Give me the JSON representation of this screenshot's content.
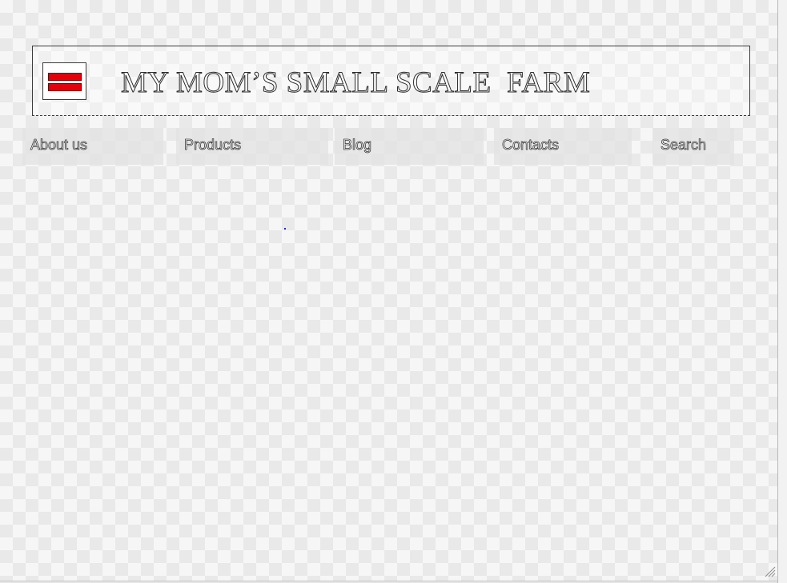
{
  "header": {
    "title": "MY MOM’S SMALL SCALE  FARM",
    "menu_icon": "hamburger-menu-icon"
  },
  "nav": {
    "items": [
      {
        "label": "About us"
      },
      {
        "label": "Products"
      },
      {
        "label": "Blog"
      },
      {
        "label": "Contacts"
      },
      {
        "label": "Search"
      }
    ]
  },
  "colors": {
    "menu_bar": "#e4000a",
    "outline": "#3a3a3a",
    "nav_background": "#e1e1e1"
  }
}
